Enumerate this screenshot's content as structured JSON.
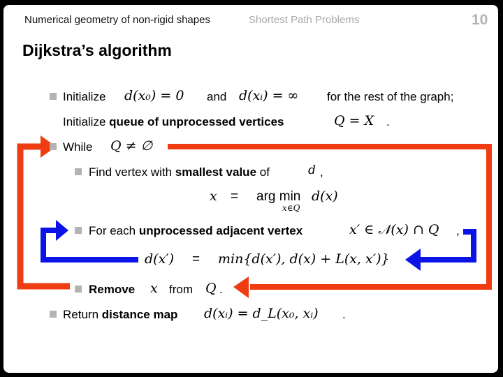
{
  "header": {
    "course_title": "Numerical geometry of non-rigid shapes",
    "section_title": "Shortest Path Problems",
    "slide_number": "10"
  },
  "title": "Dijkstra’s algorithm",
  "steps": {
    "init": {
      "label": "Initialize",
      "formula_1": "d(x₀) = 0",
      "connector": "and",
      "formula_2": "d(xᵢ) = ∞",
      "suffix": "for the rest of the graph;"
    },
    "init_queue": {
      "prefix": "Initialize",
      "bold": "queue of unprocessed vertices",
      "formula": "Q = X",
      "suffix": "."
    },
    "while": {
      "label": "While",
      "formula": "Q ≠ ∅"
    },
    "find": {
      "prefix": "Find vertex with",
      "bold": "smallest value",
      "suffix": "of",
      "symbol": "d",
      "comma": ",",
      "formula_lhs": "x",
      "formula_eq": "=",
      "formula_op": "arg min",
      "formula_sub": "x∈Q",
      "formula_rhs": "d(x)"
    },
    "for_each": {
      "prefix": "For each",
      "bold": "unprocessed adjacent vertex",
      "formula": "x′ ∈ 𝒩(x) ∩ Q",
      "comma": ",",
      "update_lhs": "d(x′)",
      "update_eq": "=",
      "update_rhs": "min{d(x′), d(x) + L(x, x′)}"
    },
    "remove": {
      "bold": "Remove",
      "symbol": "x",
      "middle": "from",
      "set": "Q",
      "suffix": "."
    },
    "return": {
      "prefix": "Return",
      "bold": "distance map",
      "formula": "d(xᵢ) = d_L(x₀, xᵢ)",
      "suffix": "."
    }
  },
  "colors": {
    "outer_loop_arrow": "#f03c12",
    "inner_loop_arrow": "#0a14e6",
    "bullet": "#b3b3b3",
    "header_sub": "#a8a8a8"
  }
}
